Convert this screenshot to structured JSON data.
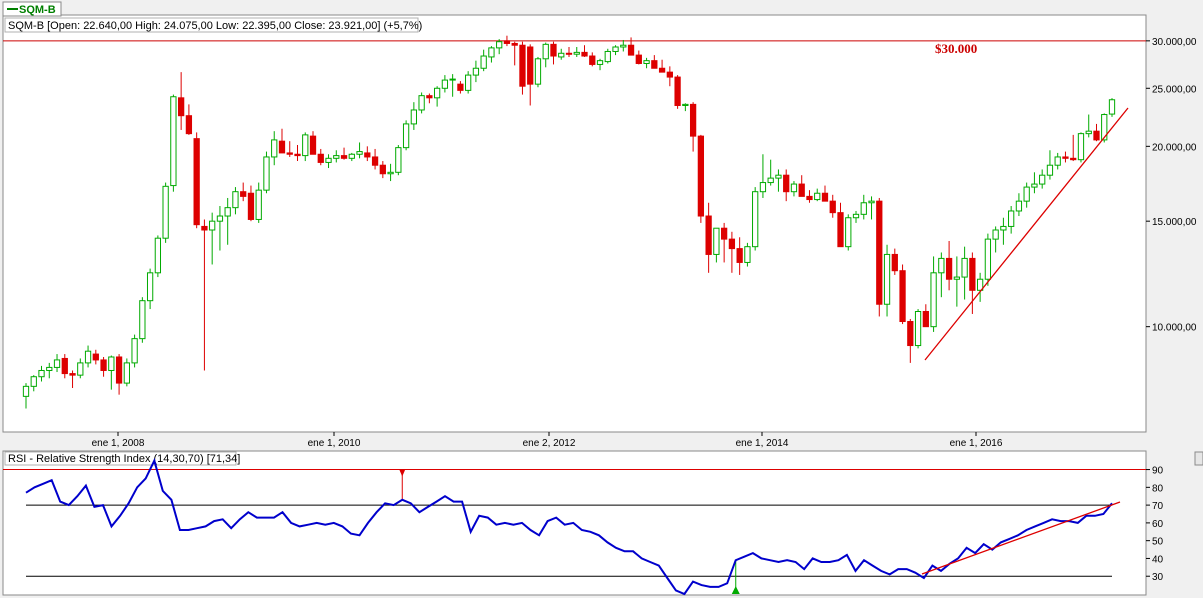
{
  "tab": {
    "label": "SQM-B"
  },
  "price_panel": {
    "header": "SQM-B [Open: 22.640,00  High: 24.075,00  Low: 22.395,00  Close: 23.921,00] (+5,7%)",
    "annotation": "$30.000",
    "resistance_level": 30000,
    "y_ticks": [
      {
        "v": 30000,
        "label": "30.000,00"
      },
      {
        "v": 25000,
        "label": "25.000,00"
      },
      {
        "v": 20000,
        "label": "20.000,00"
      },
      {
        "v": 15000,
        "label": "15.000,00"
      },
      {
        "v": 10000,
        "label": "10.000,00"
      }
    ],
    "x_ticks": [
      "ene 1, 2008",
      "ene 1, 2010",
      "ene 2, 2012",
      "ene 1, 2014",
      "ene 1, 2016"
    ]
  },
  "rsi_panel": {
    "header": "RSI - Relative Strength Index (14,30,70) [71,34]",
    "y_ticks": [
      90,
      80,
      70,
      60,
      50,
      40,
      30
    ],
    "upper_level": 70,
    "lower_level": 30,
    "extreme_level": 90
  },
  "colors": {
    "up": "#00aa00",
    "down": "#dd0000",
    "rsi": "#0000cc",
    "level": "#dd0000"
  },
  "chart_data": [
    {
      "type": "candlestick",
      "title": "SQM-B",
      "yscale": "log",
      "ylim": [
        6800,
        30800
      ],
      "candles": [
        [
          7650,
          8050,
          7300,
          7950
        ],
        [
          7950,
          8300,
          7800,
          8250
        ],
        [
          8250,
          8600,
          8100,
          8450
        ],
        [
          8450,
          8700,
          8200,
          8550
        ],
        [
          8550,
          9000,
          8400,
          8800
        ],
        [
          8850,
          9000,
          8200,
          8350
        ],
        [
          8350,
          8450,
          7900,
          8300
        ],
        [
          8300,
          8850,
          8200,
          8700
        ],
        [
          8700,
          9300,
          8550,
          9100
        ],
        [
          9000,
          9150,
          8650,
          8800
        ],
        [
          8800,
          8900,
          8250,
          8450
        ],
        [
          8450,
          8950,
          7850,
          8900
        ],
        [
          8900,
          9000,
          7700,
          8050
        ],
        [
          8050,
          8850,
          7950,
          8700
        ],
        [
          8700,
          9700,
          8550,
          9550
        ],
        [
          9550,
          11200,
          9400,
          11050
        ],
        [
          11050,
          12500,
          10700,
          12300
        ],
        [
          12300,
          14200,
          12100,
          14050
        ],
        [
          14050,
          17400,
          13800,
          17150
        ],
        [
          17200,
          24400,
          16800,
          24200
        ],
        [
          24100,
          26600,
          21300,
          22500
        ],
        [
          22500,
          23500,
          20900,
          21000
        ],
        [
          20600,
          21100,
          14600,
          14800
        ],
        [
          14700,
          15100,
          8450,
          14500
        ],
        [
          14500,
          15500,
          12700,
          15000
        ],
        [
          15000,
          15900,
          13400,
          15300
        ],
        [
          15300,
          16400,
          13700,
          15800
        ],
        [
          15800,
          17100,
          15400,
          16800
        ],
        [
          16800,
          17400,
          16200,
          16500
        ],
        [
          16700,
          17200,
          15000,
          15100
        ],
        [
          15100,
          17400,
          14900,
          16900
        ],
        [
          16900,
          19600,
          16700,
          19200
        ],
        [
          19200,
          21200,
          18600,
          20500
        ],
        [
          20400,
          21400,
          19700,
          19500
        ],
        [
          19500,
          20400,
          19200,
          19400
        ],
        [
          19400,
          20100,
          18900,
          19300
        ],
        [
          19300,
          21100,
          18900,
          20900
        ],
        [
          20800,
          21200,
          19900,
          19400
        ],
        [
          19400,
          19800,
          18600,
          18800
        ],
        [
          18800,
          19400,
          18400,
          19100
        ],
        [
          19100,
          19700,
          18800,
          19300
        ],
        [
          19300,
          19900,
          19000,
          19100
        ],
        [
          19100,
          19500,
          18900,
          19400
        ],
        [
          19400,
          20300,
          19100,
          19600
        ],
        [
          19500,
          20000,
          18900,
          19200
        ],
        [
          19200,
          19800,
          18300,
          18600
        ],
        [
          18600,
          18900,
          17700,
          18000
        ],
        [
          18000,
          18700,
          17500,
          18100
        ],
        [
          18100,
          20100,
          17900,
          19900
        ],
        [
          19900,
          22100,
          19700,
          21800
        ],
        [
          21800,
          23700,
          21300,
          23000
        ],
        [
          23000,
          24600,
          22700,
          24300
        ],
        [
          24300,
          24500,
          23600,
          24100
        ],
        [
          24100,
          25200,
          23300,
          25000
        ],
        [
          25000,
          26300,
          24600,
          25800
        ],
        [
          25800,
          26400,
          24200,
          25900
        ],
        [
          25400,
          25700,
          24500,
          24800
        ],
        [
          24800,
          26700,
          24500,
          26300
        ],
        [
          26300,
          27800,
          25600,
          27000
        ],
        [
          27000,
          29000,
          26700,
          28300
        ],
        [
          28200,
          29400,
          27600,
          29200
        ],
        [
          29200,
          30200,
          28500,
          29900
        ],
        [
          30000,
          30600,
          29400,
          29700
        ],
        [
          29700,
          29900,
          27300,
          29500
        ],
        [
          29500,
          29900,
          24400,
          25200
        ],
        [
          29300,
          29600,
          23400,
          25400
        ],
        [
          25400,
          28200,
          25100,
          28000
        ],
        [
          28000,
          29800,
          27100,
          29600
        ],
        [
          29600,
          29900,
          27400,
          28300
        ],
        [
          28200,
          29100,
          27900,
          28600
        ],
        [
          28600,
          29300,
          28200,
          28500
        ],
        [
          28500,
          29300,
          28200,
          28700
        ],
        [
          28700,
          29500,
          28200,
          28300
        ],
        [
          28300,
          28700,
          27200,
          27400
        ],
        [
          27400,
          28000,
          26800,
          27800
        ],
        [
          27700,
          29100,
          27500,
          28800
        ],
        [
          28800,
          29500,
          28400,
          29300
        ],
        [
          29300,
          30100,
          28800,
          29500
        ],
        [
          29500,
          30400,
          28800,
          28400
        ],
        [
          28400,
          28900,
          27400,
          27500
        ],
        [
          27500,
          28100,
          27000,
          27800
        ],
        [
          27800,
          28400,
          27200,
          27000
        ],
        [
          27000,
          27900,
          26600,
          26600
        ],
        [
          26600,
          27200,
          25200,
          26100
        ],
        [
          26100,
          26300,
          23100,
          23400
        ],
        [
          23400,
          23600,
          22900,
          23500
        ],
        [
          23500,
          23700,
          19600,
          20800
        ],
        [
          20800,
          20900,
          14900,
          15300
        ],
        [
          15300,
          16100,
          12300,
          13200
        ],
        [
          13200,
          14200,
          12800,
          14600
        ],
        [
          14600,
          14900,
          12800,
          14000
        ],
        [
          14000,
          14400,
          12300,
          13500
        ],
        [
          13500,
          14100,
          12200,
          12800
        ],
        [
          12800,
          13800,
          12600,
          13600
        ],
        [
          13600,
          17100,
          13400,
          16800
        ],
        [
          16800,
          19400,
          16400,
          17400
        ],
        [
          17400,
          19000,
          17200,
          17700
        ],
        [
          17700,
          18300,
          16800,
          17900
        ],
        [
          17900,
          18300,
          16200,
          16800
        ],
        [
          16800,
          17500,
          16500,
          17300
        ],
        [
          17300,
          17900,
          16600,
          16500
        ],
        [
          16500,
          16900,
          16100,
          16300
        ],
        [
          16300,
          17000,
          16200,
          16700
        ],
        [
          16700,
          17200,
          16400,
          16200
        ],
        [
          16200,
          16600,
          15200,
          15500
        ],
        [
          15500,
          16100,
          13600,
          13600
        ],
        [
          13600,
          15400,
          13400,
          15200
        ],
        [
          15200,
          15600,
          14900,
          15400
        ],
        [
          15400,
          16600,
          15100,
          16100
        ],
        [
          16100,
          16500,
          15100,
          16200
        ],
        [
          16200,
          16400,
          10400,
          10900
        ],
        [
          10900,
          13700,
          10400,
          13200
        ],
        [
          13200,
          13500,
          12200,
          12400
        ],
        [
          12400,
          12700,
          10100,
          10200
        ],
        [
          10200,
          10300,
          8700,
          9300
        ],
        [
          9300,
          10700,
          9200,
          10600
        ],
        [
          10600,
          10900,
          10100,
          10000
        ],
        [
          10000,
          13100,
          9800,
          12300
        ],
        [
          12300,
          13300,
          11200,
          13000
        ],
        [
          13000,
          13900,
          11500,
          12000
        ],
        [
          12000,
          13100,
          10800,
          12100
        ],
        [
          12100,
          13600,
          11100,
          13000
        ],
        [
          13000,
          13300,
          10500,
          11500
        ],
        [
          11500,
          12300,
          11000,
          12000
        ],
        [
          12000,
          14300,
          11700,
          14000
        ],
        [
          14000,
          14700,
          13300,
          14500
        ],
        [
          14500,
          15200,
          13700,
          14700
        ],
        [
          14700,
          15900,
          14300,
          15600
        ],
        [
          15600,
          16700,
          15300,
          16200
        ],
        [
          16200,
          17400,
          15800,
          17100
        ],
        [
          17100,
          18100,
          16700,
          17300
        ],
        [
          17300,
          18300,
          17000,
          17900
        ],
        [
          17900,
          19700,
          17600,
          18600
        ],
        [
          18600,
          19500,
          18300,
          19200
        ],
        [
          19200,
          19600,
          18800,
          19100
        ],
        [
          19100,
          20900,
          18900,
          19000
        ],
        [
          19000,
          21100,
          18800,
          21000
        ],
        [
          21000,
          22600,
          20700,
          21200
        ],
        [
          21200,
          21800,
          20400,
          20500
        ],
        [
          20500,
          22700,
          20300,
          22600
        ],
        [
          22640,
          24075,
          22395,
          23921
        ]
      ]
    },
    {
      "type": "line",
      "title": "RSI - Relative Strength Index (14,30,70) [71,34]",
      "ylim": [
        20,
        92
      ],
      "values": [
        77,
        80,
        82,
        84,
        72,
        70,
        75,
        81,
        69,
        70,
        58,
        64,
        71,
        80,
        85,
        95,
        78,
        73,
        56,
        56,
        57,
        58,
        61,
        62,
        57,
        62,
        66,
        63,
        63,
        63,
        66,
        60,
        58,
        59,
        60,
        59,
        60,
        58,
        54,
        53,
        60,
        66,
        71,
        70,
        73,
        71,
        66,
        69,
        72,
        75,
        72,
        72,
        55,
        64,
        63,
        59,
        60,
        59,
        60,
        56,
        53,
        61,
        63,
        59,
        60,
        56,
        55,
        53,
        49,
        46,
        44,
        44,
        40,
        38,
        36,
        29,
        22,
        20,
        27,
        25,
        24,
        24,
        26,
        39,
        41,
        43,
        40,
        39,
        38,
        39,
        38,
        34,
        40,
        38,
        38,
        39,
        42,
        33,
        39,
        36,
        33,
        31,
        34,
        34,
        32,
        29,
        36,
        33,
        37,
        40,
        46,
        43,
        48,
        45,
        49,
        51,
        53,
        56,
        58,
        60,
        62,
        61,
        61,
        60,
        64,
        64,
        65,
        71
      ]
    }
  ]
}
